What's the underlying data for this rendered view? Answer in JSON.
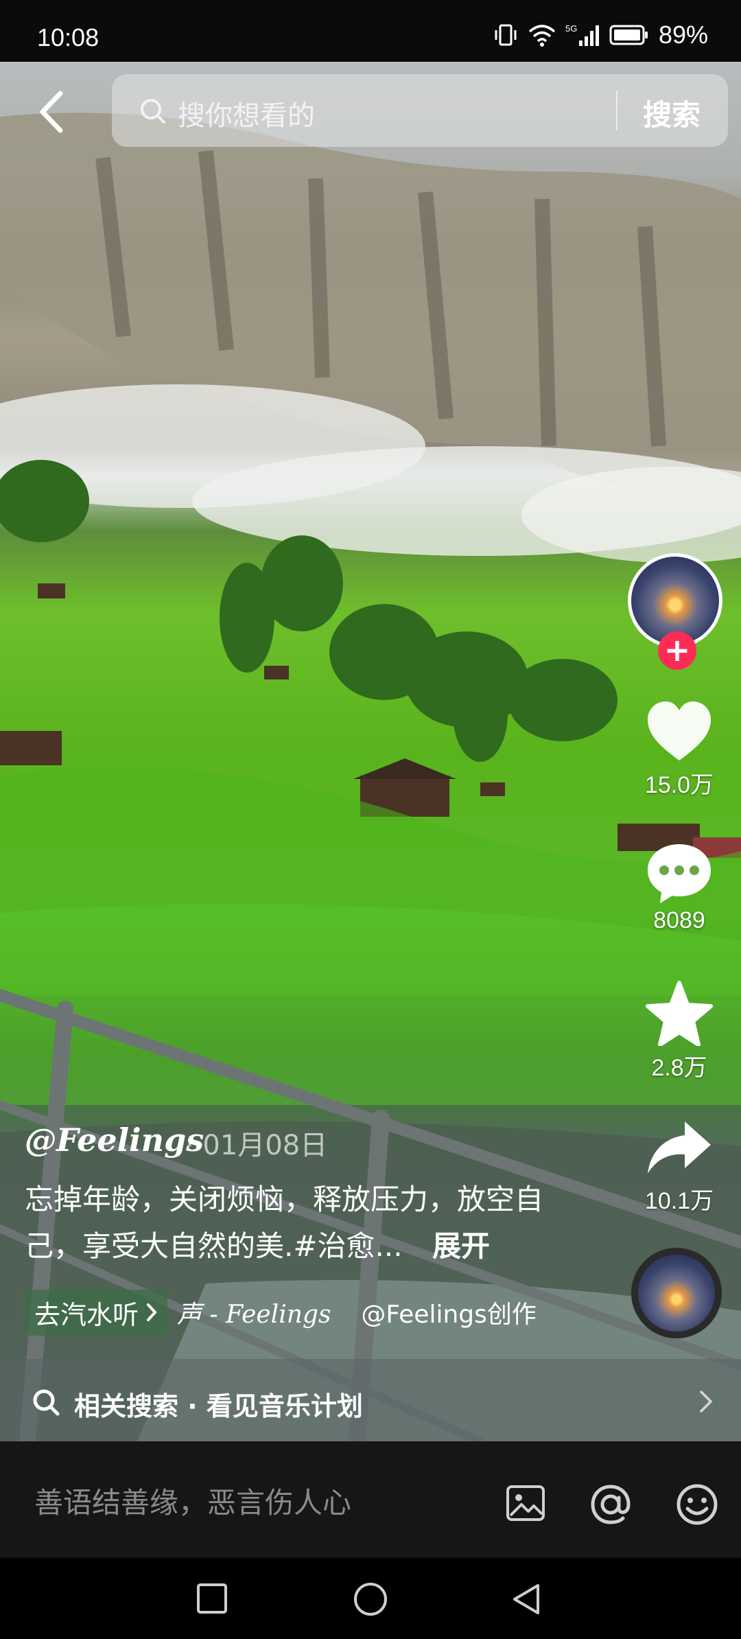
{
  "status": {
    "time": "10:08",
    "network": "5G",
    "battery": "89%"
  },
  "search": {
    "placeholder": "搜你想看的",
    "button": "搜索"
  },
  "actions": {
    "likes": "15.0万",
    "comments": "8089",
    "favorites": "2.8万",
    "shares": "10.1万",
    "follow_symbol": "+"
  },
  "post": {
    "author": "@Feelings",
    "date": "· 01月08日",
    "caption": "忘掉年龄，关闭烦恼，释放压力，放空自己，享受大自然的美.#治愈...",
    "expand": "展开",
    "music_pill": "去汽水听",
    "music_name": "声 - Feelings",
    "creator": "@Feelings创作"
  },
  "related": {
    "text": "相关搜索 · 看见音乐计划"
  },
  "comment": {
    "placeholder": "善语结善缘，恶言伤人心"
  },
  "colors": {
    "follow_red": "#fe2c55",
    "accent_white": "#ffffff"
  }
}
